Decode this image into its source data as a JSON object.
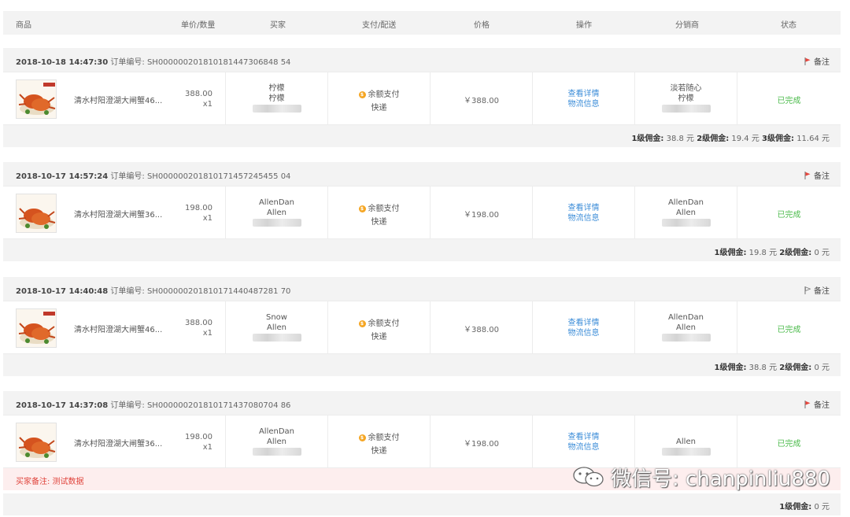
{
  "columns": [
    "商品",
    "单价/数量",
    "买家",
    "支付/配送",
    "价格",
    "操作",
    "分销商",
    "状态"
  ],
  "orders": [
    {
      "datetime": "2018-10-18 14:47:30",
      "order_label": "订单编号:",
      "order_no": "SH000000201810181447306848 54",
      "note_label": "备注",
      "note_flag_color": "#e8453c",
      "product_title": "清水村阳澄湖大闸蟹46...",
      "unit_price": "388.00",
      "qty": "x1",
      "buyer_nick": "柠檬",
      "buyer_name": "柠檬",
      "pay_method": "余额支付",
      "delivery": "快递",
      "price": "￥388.00",
      "action_detail": "查看详情",
      "action_logistics": "物流信息",
      "distributor_nick": "淡若随心",
      "distributor_name": "柠檬",
      "status": "已完成",
      "commission": [
        {
          "label": "1级佣金:",
          "value": "38.8 元"
        },
        {
          "label": "2级佣金:",
          "value": "19.4 元"
        },
        {
          "label": "3级佣金:",
          "value": "11.64 元"
        }
      ],
      "buyer_note": null
    },
    {
      "datetime": "2018-10-17 14:57:24",
      "order_label": "订单编号:",
      "order_no": "SH000000201810171457245455 04",
      "note_label": "备注",
      "note_flag_color": "#e8453c",
      "product_title": "清水村阳澄湖大闸蟹36...",
      "unit_price": "198.00",
      "qty": "x1",
      "buyer_nick": "AllenDan",
      "buyer_name": "Allen",
      "pay_method": "余额支付",
      "delivery": "快递",
      "price": "￥198.00",
      "action_detail": "查看详情",
      "action_logistics": "物流信息",
      "distributor_nick": "AllenDan",
      "distributor_name": "Allen",
      "status": "已完成",
      "commission": [
        {
          "label": "1级佣金:",
          "value": "19.8 元"
        },
        {
          "label": "2级佣金:",
          "value": "0 元"
        }
      ],
      "buyer_note": null
    },
    {
      "datetime": "2018-10-17 14:40:48",
      "order_label": "订单编号:",
      "order_no": "SH000000201810171440487281 70",
      "note_label": "备注",
      "note_flag_color": "#888888",
      "product_title": "清水村阳澄湖大闸蟹46...",
      "unit_price": "388.00",
      "qty": "x1",
      "buyer_nick": "Snow",
      "buyer_name": "Allen",
      "pay_method": "余额支付",
      "delivery": "快递",
      "price": "￥388.00",
      "action_detail": "查看详情",
      "action_logistics": "物流信息",
      "distributor_nick": "AllenDan",
      "distributor_name": "Allen",
      "status": "已完成",
      "commission": [
        {
          "label": "1级佣金:",
          "value": "38.8 元"
        },
        {
          "label": "2级佣金:",
          "value": "0 元"
        }
      ],
      "buyer_note": null
    },
    {
      "datetime": "2018-10-17 14:37:08",
      "order_label": "订单编号:",
      "order_no": "SH000000201810171437080704 86",
      "note_label": "备注",
      "note_flag_color": "#e8453c",
      "product_title": "清水村阳澄湖大闸蟹36...",
      "unit_price": "198.00",
      "qty": "x1",
      "buyer_nick": "AllenDan",
      "buyer_name": "Allen",
      "pay_method": "余额支付",
      "delivery": "快递",
      "price": "￥198.00",
      "action_detail": "查看详情",
      "action_logistics": "物流信息",
      "distributor_nick": "",
      "distributor_name": "Allen",
      "status": "已完成",
      "commission": [
        {
          "label": "1级佣金:",
          "value": "0 元"
        }
      ],
      "buyer_note": "买家备注: 测试数据"
    }
  ],
  "watermark": "微信号: chanpinliu880"
}
